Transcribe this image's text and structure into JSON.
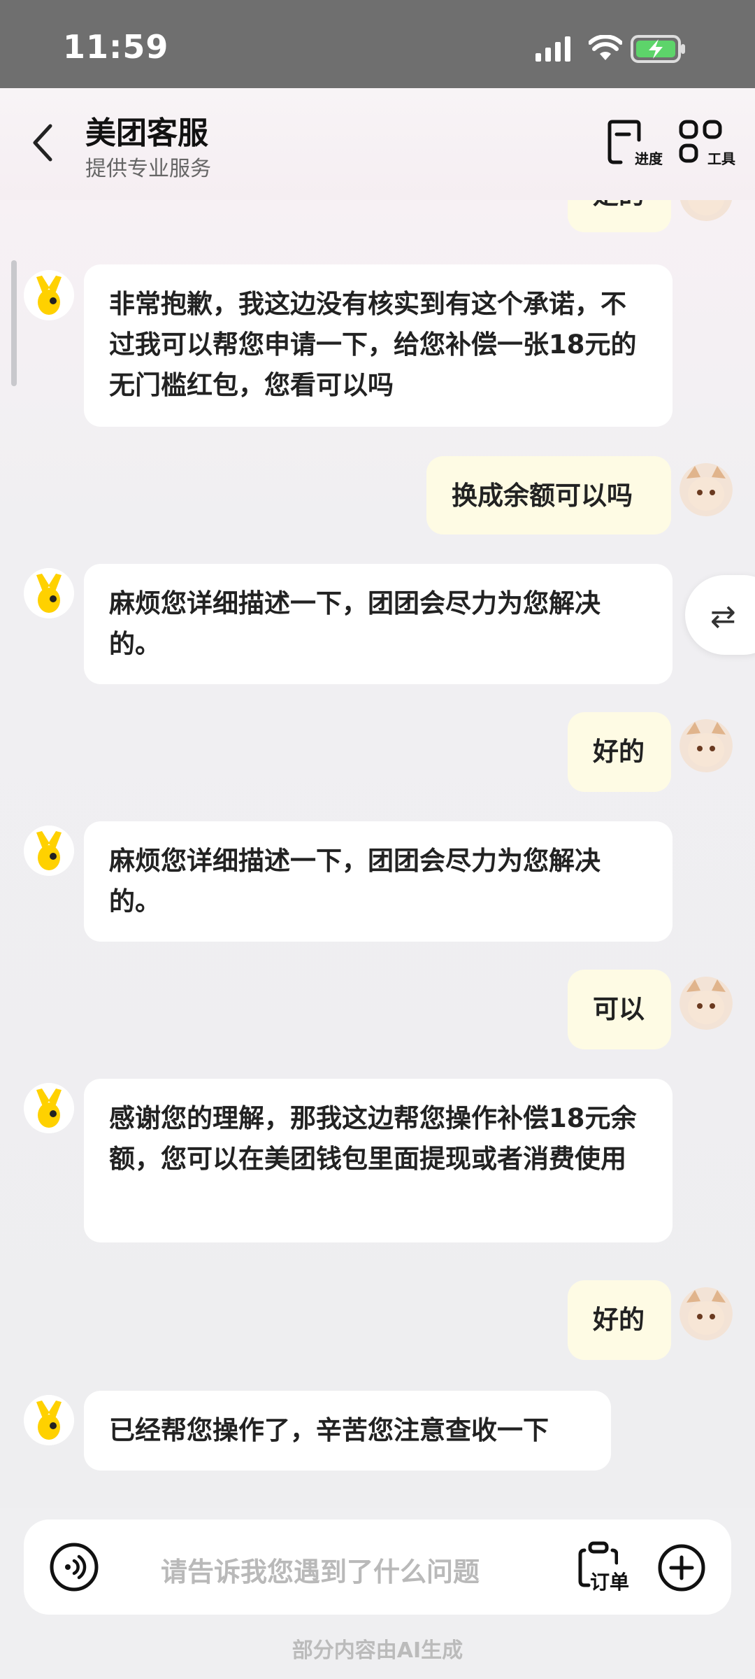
{
  "status": {
    "time": "11:59"
  },
  "header": {
    "title": "美团客服",
    "subtitle": "提供专业服务",
    "progress_label": "进度",
    "tools_label": "工具"
  },
  "messages": [
    {
      "role": "user",
      "text": "是的"
    },
    {
      "role": "bot",
      "text": "非常抱歉，我这边没有核实到有这个承诺，不过我可以帮您申请一下，给您补偿一张18元的无门槛红包，您看可以吗"
    },
    {
      "role": "user",
      "text": "换成余额可以吗"
    },
    {
      "role": "bot",
      "text": "麻烦您详细描述一下，团团会尽力为您解决的。"
    },
    {
      "role": "user",
      "text": "好的"
    },
    {
      "role": "bot",
      "text": "麻烦您详细描述一下，团团会尽力为您解决的。"
    },
    {
      "role": "user",
      "text": "可以"
    },
    {
      "role": "bot",
      "text": "感谢您的理解，那我这边帮您操作补偿18元余额，您可以在美团钱包里面提现或者消费使用"
    },
    {
      "role": "user",
      "text": "好的"
    },
    {
      "role": "bot",
      "text": "已经帮您操作了，辛苦您注意查收一下"
    }
  ],
  "input": {
    "placeholder": "请告诉我您遇到了什么问题",
    "order_label": "订单"
  },
  "footer": {
    "note": "部分内容由AI生成"
  },
  "swap_icon": "⇄",
  "colors": {
    "user_bubble": "#fefbe4",
    "bot_bubble": "#ffffff",
    "brand_yellow": "#ffd100"
  }
}
